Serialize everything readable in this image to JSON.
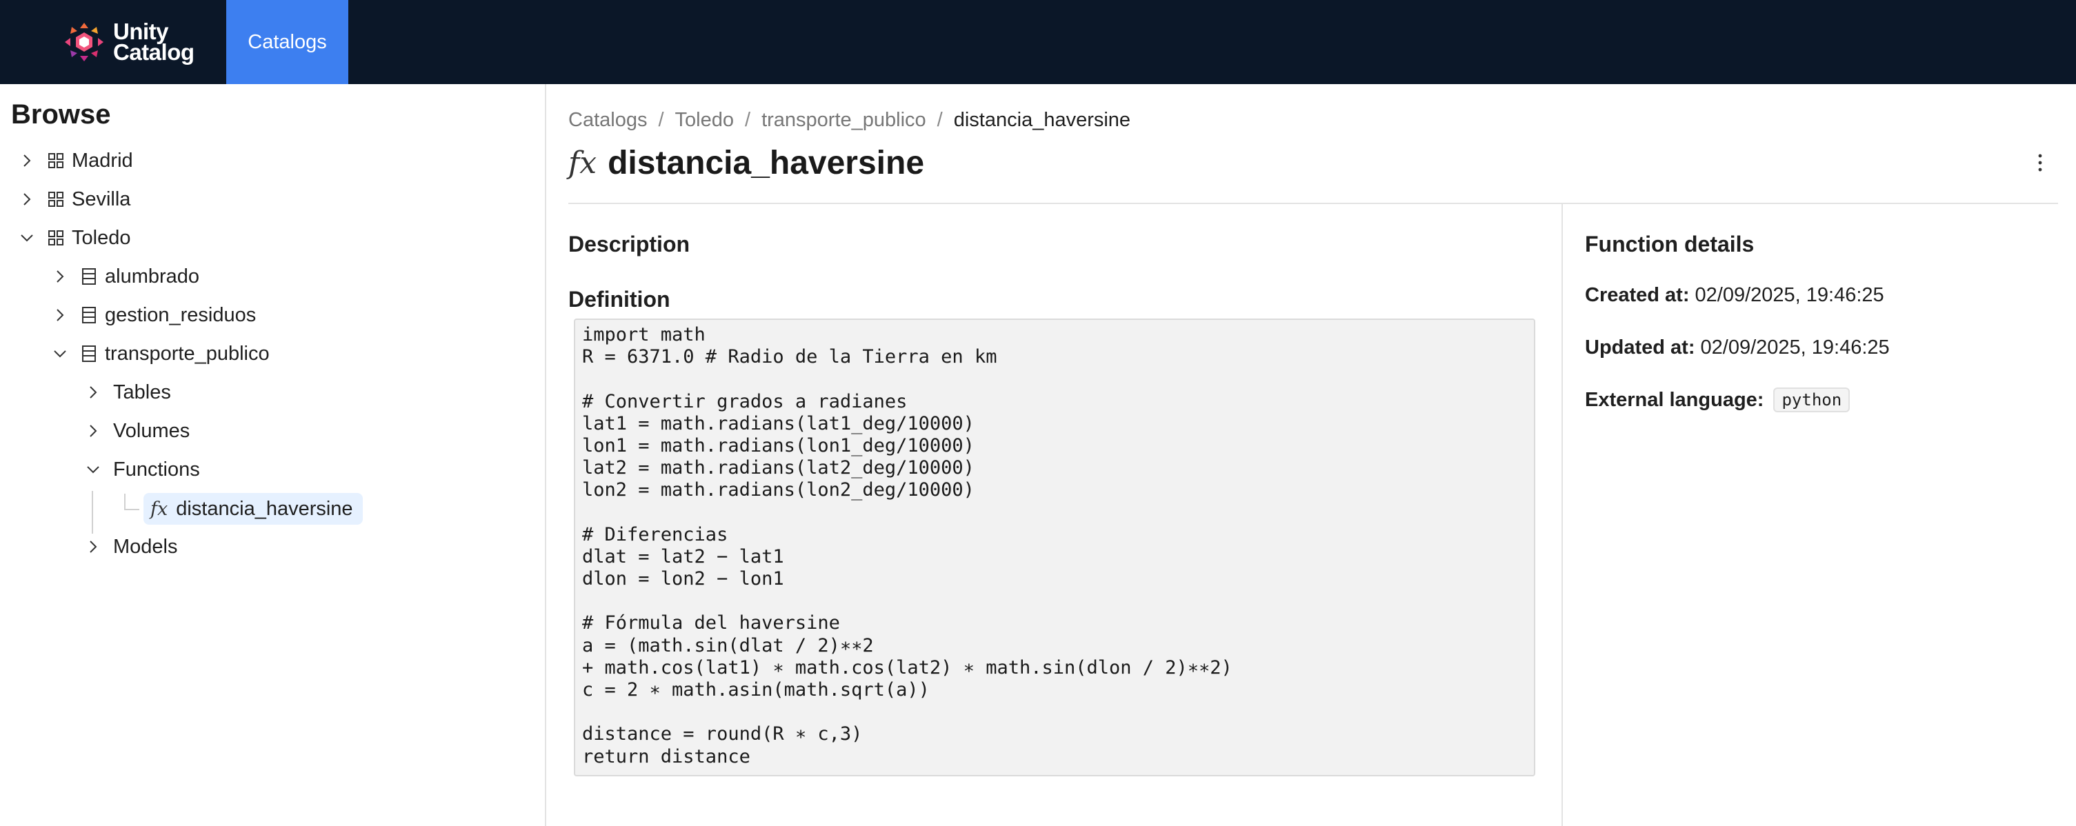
{
  "header": {
    "brand_line1": "Unity",
    "brand_line2": "Catalog",
    "nav_tab": "Catalogs"
  },
  "sidebar": {
    "title": "Browse",
    "tree": {
      "madrid": "Madrid",
      "sevilla": "Sevilla",
      "toledo": "Toledo",
      "alumbrado": "alumbrado",
      "gestion_residuos": "gestion_residuos",
      "transporte_publico": "transporte_publico",
      "tables": "Tables",
      "volumes": "Volumes",
      "functions": "Functions",
      "function_item": "distancia_haversine",
      "models": "Models"
    }
  },
  "breadcrumb": {
    "catalogs": "Catalogs",
    "catalog": "Toledo",
    "schema": "transporte_publico",
    "current": "distancia_haversine",
    "separator": "/"
  },
  "page": {
    "fx_symbol": "fx",
    "title": "distancia_haversine",
    "description_heading": "Description",
    "definition_heading": "Definition",
    "code_lines": [
      "import math",
      "R = 6371.0 # Radio de la Tierra en km",
      "",
      "# Convertir grados a radianes",
      "lat1 = math.radians(lat1_deg/10000)",
      "lon1 = math.radians(lon1_deg/10000)",
      "lat2 = math.radians(lat2_deg/10000)",
      "lon2 = math.radians(lon2_deg/10000)",
      "",
      "# Diferencias",
      "dlat = lat2 − lat1",
      "dlon = lon2 − lon1",
      "",
      "# Fórmula del haversine",
      "a = (math.sin(dlat / 2)∗∗2",
      "+ math.cos(lat1) ∗ math.cos(lat2) ∗ math.sin(dlon / 2)∗∗2)",
      "c = 2 ∗ math.asin(math.sqrt(a))",
      "",
      "distance = round(R ∗ c,3)",
      "return distance"
    ]
  },
  "details": {
    "heading": "Function details",
    "created_label": "Created at:",
    "created_value": "02/09/2025, 19:46:25",
    "updated_label": "Updated at:",
    "updated_value": "02/09/2025, 19:46:25",
    "language_label": "External language:",
    "language_value": "python"
  },
  "colors": {
    "topbar": "#0b1728",
    "active_tab": "#3d7ff0",
    "selected_item": "#e6f1ff"
  }
}
